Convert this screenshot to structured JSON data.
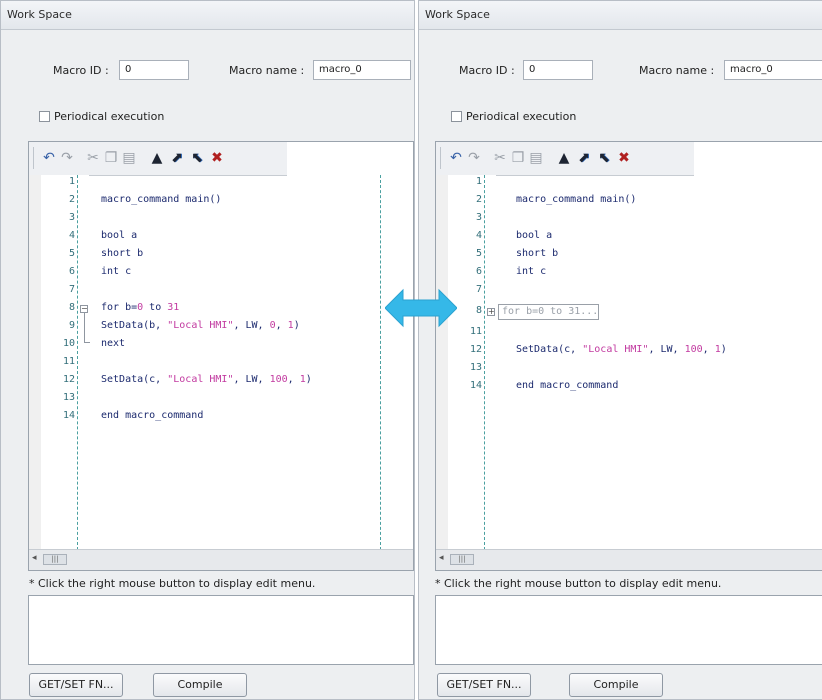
{
  "panels": [
    {
      "title": "Work Space",
      "macro_id_label": "Macro ID :",
      "macro_id_value": "0",
      "macro_name_label": "Macro name :",
      "macro_name_value": "macro_0",
      "periodic_label": "Periodical execution",
      "line_numbers": [
        "1",
        "2",
        "3",
        "4",
        "5",
        "6",
        "7",
        "8",
        "9",
        "10",
        "11",
        "12",
        "13",
        "14"
      ],
      "code": {
        "main": "macro_command main()",
        "decl_a": "bool a",
        "decl_b": "short b",
        "decl_c": "int c",
        "for_kw": "for b=",
        "for_start": "0",
        "for_to": " to ",
        "for_end": "31",
        "setdata1_a": "SetData(b, ",
        "setdata1_str": "\"Local HMI\"",
        "setdata1_b": ", LW, ",
        "setdata1_n1": "0",
        "setdata1_c": ", ",
        "setdata1_n2": "1",
        "setdata1_d": ")",
        "next": "next",
        "setdata2_a": "SetData(c, ",
        "setdata2_str": "\"Local HMI\"",
        "setdata2_b": ", LW, ",
        "setdata2_n1": "100",
        "setdata2_c": ", ",
        "setdata2_n2": "1",
        "setdata2_d": ")",
        "end": "end macro_command"
      },
      "hint": "* Click the right mouse button to display edit menu.",
      "get_set_button": "GET/SET FN...",
      "compile_button": "Compile"
    },
    {
      "title": "Work Space",
      "macro_id_label": "Macro ID :",
      "macro_id_value": "0",
      "macro_name_label": "Macro name :",
      "macro_name_value": "macro_0",
      "periodic_label": "Periodical execution",
      "line_numbers": [
        "1",
        "2",
        "3",
        "4",
        "5",
        "6",
        "7",
        "8",
        "11",
        "12",
        "13",
        "14"
      ],
      "code": {
        "main": "macro_command main()",
        "decl_a": "bool a",
        "decl_b": "short b",
        "decl_c": "int c",
        "collapsed_for": "for b=0 to 31...",
        "setdata2_a": "SetData(c, ",
        "setdata2_str": "\"Local HMI\"",
        "setdata2_b": ", LW, ",
        "setdata2_n1": "100",
        "setdata2_c": ", ",
        "setdata2_n2": "1",
        "setdata2_d": ")",
        "end": "end macro_command"
      },
      "hint": "* Click the right mouse button to display edit menu.",
      "get_set_button": "GET/SET FN...",
      "compile_button": "Compile"
    }
  ],
  "icons": {
    "undo": "undo-icon",
    "redo": "redo-icon",
    "cut": "cut-icon",
    "copy": "copy-icon",
    "paste": "paste-icon",
    "toggle_bookmark": "toggle-bookmark-icon",
    "next_bookmark": "next-bookmark-icon",
    "prev_bookmark": "previous-bookmark-icon",
    "clear_bookmarks": "clear-bookmarks-icon",
    "compare_arrow": "double-arrow-icon"
  },
  "colors": {
    "arrow": "#35b8e8",
    "keyword_text": "#1c2a6e",
    "string_text": "#c23aa0",
    "line_number": "#336f7a"
  }
}
